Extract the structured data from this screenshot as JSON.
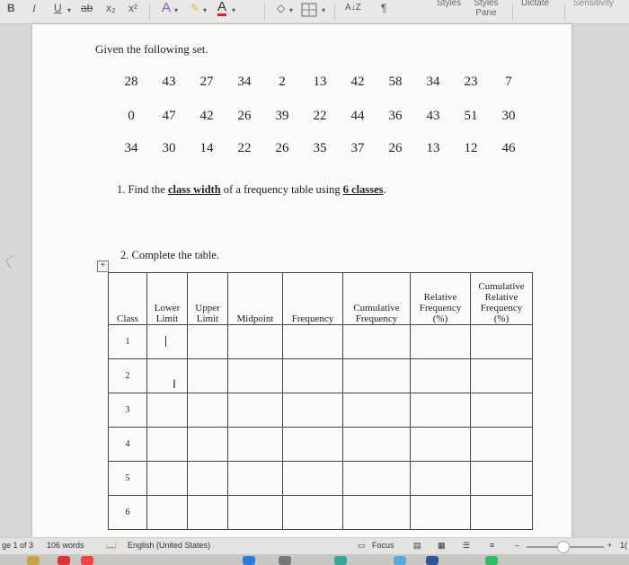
{
  "ribbon": {
    "bold": "B",
    "italic": "I",
    "underline": "U",
    "strike": "ab",
    "subscript": "x₂",
    "superscript": "x²",
    "font_color": "A",
    "highlight": "✎",
    "text_color": "A",
    "sort": "A↓Z",
    "pilcrow": "¶",
    "styles": "Styles",
    "styles_pane": "Styles\nPane",
    "dictate": "Dictate",
    "sensitivity": "Sensitivity"
  },
  "document": {
    "heading": "Given the following set.",
    "data_rows": [
      [
        "28",
        "43",
        "27",
        "34",
        "2",
        "13",
        "42",
        "58",
        "34",
        "23",
        "7"
      ],
      [
        "0",
        "47",
        "42",
        "26",
        "39",
        "22",
        "44",
        "36",
        "43",
        "51",
        "30"
      ],
      [
        "34",
        "30",
        "14",
        "22",
        "26",
        "35",
        "37",
        "26",
        "13",
        "12",
        "46"
      ]
    ],
    "question1": {
      "prefix": "1. Find the ",
      "term": "class width",
      "middle": " of a frequency table using ",
      "classes": "6 classes",
      "suffix": "."
    },
    "question2": "2. Complete the table.",
    "table_handle": "+",
    "table": {
      "headers": [
        "Class",
        "Lower Limit",
        "Upper Limit",
        "Midpoint",
        "Frequency",
        "Cumulative Frequency",
        "Relative Frequency (%)",
        "Cumulative Relative Frequency (%)"
      ],
      "classes": [
        "1",
        "2",
        "3",
        "4",
        "5",
        "6"
      ]
    }
  },
  "status": {
    "page": "ge 1 of 3",
    "words": "106 words",
    "language": "English (United States)",
    "focus": "Focus",
    "zoom_plus": "+",
    "zoom_value": "1("
  },
  "colors": {
    "ribbon_bg": "#e9e8e6",
    "page_bg": "#fbfbfa",
    "accent_blue": "#2b5797"
  }
}
